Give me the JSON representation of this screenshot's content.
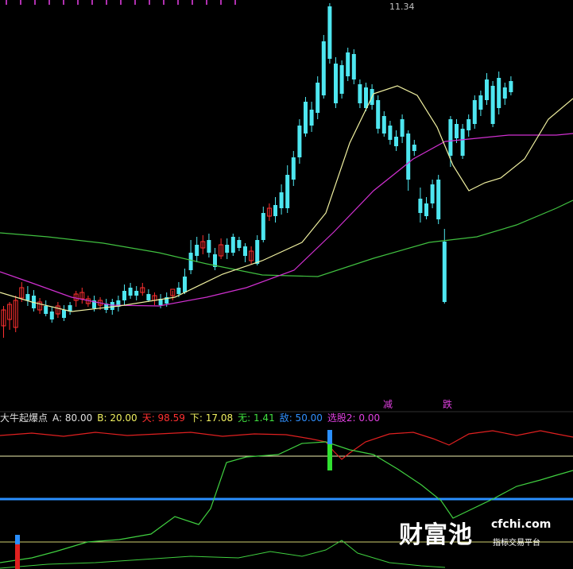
{
  "chart_data": [
    {
      "type": "candlestick",
      "panel": "price",
      "peak_annotation": "11.34",
      "signal_labels": [
        "减",
        "跌"
      ],
      "moving_averages": [
        "short-ma-yellow",
        "mid-ma-magenta",
        "long-ma-green"
      ],
      "colors": {
        "up": "#ff3030",
        "down": "#4ee6f0",
        "ma_short": "#f0f0a0",
        "ma_mid": "#d030d0",
        "ma_long": "#40c040"
      }
    },
    {
      "type": "line",
      "panel": "indicator",
      "name": "大牛起爆点",
      "legend": [
        {
          "text": "大牛起爆点",
          "color": "#e0e0e0"
        },
        {
          "text": "A: 80.00",
          "color": "#e0e0e0"
        },
        {
          "text": "B: 20.00",
          "color": "#f0f060"
        },
        {
          "text": "天: 98.59",
          "color": "#ff3030"
        },
        {
          "text": "下: 17.08",
          "color": "#f0f060"
        },
        {
          "text": "无: 1.41",
          "color": "#40e040"
        },
        {
          "text": "敌: 50.00",
          "color": "#3090ff"
        },
        {
          "text": "选股2: 0.00",
          "color": "#e040e0"
        }
      ],
      "reference_lines": [
        80,
        50,
        20
      ],
      "series_values": {
        "天": 98.59,
        "下": 17.08,
        "无": 1.41,
        "敌": 50.0,
        "选股2": 0.0
      }
    }
  ],
  "watermark": {
    "logo": "财富池",
    "url": "cfchi.com",
    "tagline": "指标交易平台"
  }
}
